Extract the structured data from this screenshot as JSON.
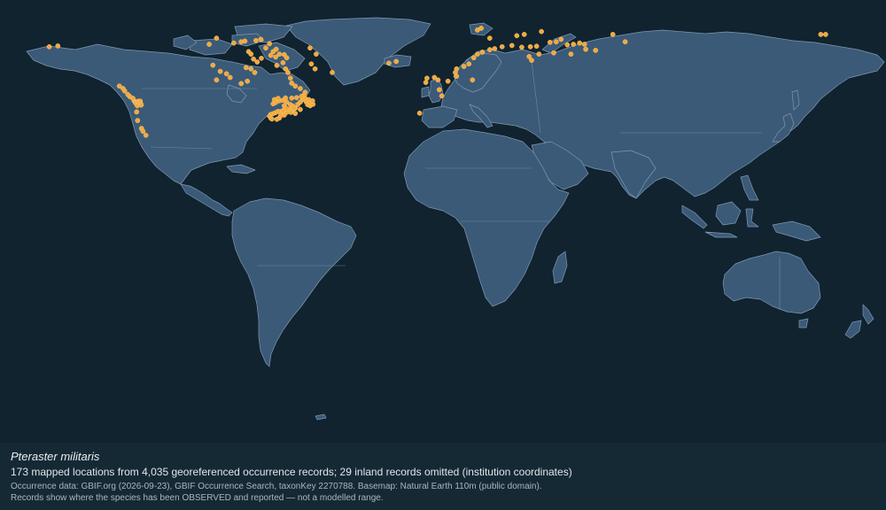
{
  "caption": {
    "species": "Pteraster militaris",
    "summary": "173 mapped locations from 4,035 georeferenced occurrence records; 29 inland records omitted (institution coordinates)",
    "source": "Occurrence data: GBIF.org (2026-09-23), GBIF Occurrence Search, taxonKey 2270788. Basemap: Natural Earth 110m (public domain).",
    "note": "Records show where the species has been OBSERVED and reported — not a modelled range."
  },
  "colors": {
    "ocean": "#10232f",
    "land": "#3b5a78",
    "border": "#7f98b2",
    "occurrence_point": "#f2a93b",
    "caption_bg": "#152935"
  },
  "map": {
    "projection": "equirectangular",
    "basemap": "Natural Earth 110m",
    "occurrences": [
      [
        -125.5,
        49.0
      ],
      [
        -125.0,
        48.4
      ],
      [
        -124.8,
        48.1
      ],
      [
        -124.5,
        47.6
      ],
      [
        -124.2,
        47.0
      ],
      [
        -123.9,
        48.8
      ],
      [
        -123.4,
        48.4
      ],
      [
        -123.0,
        48.9
      ],
      [
        -122.8,
        47.8
      ],
      [
        -122.6,
        47.3
      ],
      [
        -126.0,
        50.0
      ],
      [
        -127.2,
        50.7
      ],
      [
        -128.0,
        51.5
      ],
      [
        -129.3,
        53.0
      ],
      [
        -130.0,
        54.0
      ],
      [
        -131.5,
        55.0
      ],
      [
        -124.5,
        44.5
      ],
      [
        -124.1,
        41.0
      ],
      [
        -122.5,
        37.8
      ],
      [
        -121.9,
        36.6
      ],
      [
        -120.7,
        35.0
      ],
      [
        -160.0,
        71.0
      ],
      [
        -156.5,
        71.3
      ],
      [
        -95.0,
        72.0
      ],
      [
        -92.0,
        74.5
      ],
      [
        -85.0,
        72.5
      ],
      [
        -82.0,
        73.0
      ],
      [
        -80.5,
        73.3
      ],
      [
        -79.0,
        69.0
      ],
      [
        -78.0,
        68.0
      ],
      [
        -77.0,
        66.0
      ],
      [
        -75.5,
        64.8
      ],
      [
        -73.8,
        66.3
      ],
      [
        -70.0,
        67.5
      ],
      [
        -68.0,
        66.8
      ],
      [
        -65.0,
        64.5
      ],
      [
        -64.0,
        62.0
      ],
      [
        -63.0,
        60.5
      ],
      [
        -62.0,
        58.3
      ],
      [
        -61.5,
        56.2
      ],
      [
        -60.0,
        55.0
      ],
      [
        -58.0,
        54.0
      ],
      [
        -56.0,
        52.5
      ],
      [
        -67.5,
        63.4
      ],
      [
        -66.5,
        68.0
      ],
      [
        -64.5,
        67.8
      ],
      [
        -63.5,
        66.5
      ],
      [
        -72.0,
        70.5
      ],
      [
        -70.5,
        72.2
      ],
      [
        -74.0,
        74.0
      ],
      [
        -76.0,
        73.5
      ],
      [
        -69.0,
        69.0
      ],
      [
        -67.8,
        70.0
      ],
      [
        -88.0,
        60.0
      ],
      [
        -86.5,
        58.5
      ],
      [
        -92.0,
        57.5
      ],
      [
        -80.0,
        62.5
      ],
      [
        -78.0,
        62.0
      ],
      [
        -76.5,
        60.5
      ],
      [
        -79.5,
        57.0
      ],
      [
        -82.0,
        56.0
      ],
      [
        -93.5,
        63.5
      ],
      [
        -90.5,
        61.0
      ],
      [
        -52.0,
        62.0
      ],
      [
        -53.5,
        64.0
      ],
      [
        -51.5,
        68.0
      ],
      [
        -54.0,
        70.5
      ],
      [
        -45.0,
        60.5
      ],
      [
        -69.0,
        47.8
      ],
      [
        -68.0,
        48.3
      ],
      [
        -66.5,
        49.0
      ],
      [
        -65.0,
        49.2
      ],
      [
        -63.5,
        48.5
      ],
      [
        -62.0,
        47.5
      ],
      [
        -61.0,
        46.8
      ],
      [
        -60.0,
        46.0
      ],
      [
        -59.0,
        47.5
      ],
      [
        -58.0,
        48.5
      ],
      [
        -57.0,
        49.5
      ],
      [
        -56.0,
        50.0
      ],
      [
        -55.5,
        48.5
      ],
      [
        -55.0,
        47.5
      ],
      [
        -54.0,
        47.0
      ],
      [
        -53.5,
        48.0
      ],
      [
        -52.8,
        47.6
      ],
      [
        -53.0,
        49.0
      ],
      [
        -54.5,
        49.5
      ],
      [
        -56.5,
        51.3
      ],
      [
        -64.5,
        47.0
      ],
      [
        -64.0,
        46.0
      ],
      [
        -63.0,
        45.0
      ],
      [
        -62.0,
        44.8
      ],
      [
        -61.0,
        45.3
      ],
      [
        -60.5,
        46.2
      ],
      [
        -66.0,
        44.5
      ],
      [
        -65.5,
        43.8
      ],
      [
        -64.5,
        43.2
      ],
      [
        -63.5,
        44.3
      ],
      [
        -67.0,
        44.7
      ],
      [
        -68.0,
        44.2
      ],
      [
        -69.0,
        43.8
      ],
      [
        -70.0,
        43.5
      ],
      [
        -70.5,
        42.8
      ],
      [
        -70.0,
        42.0
      ],
      [
        -69.5,
        41.6
      ],
      [
        -66.5,
        42.0
      ],
      [
        -67.5,
        41.5
      ],
      [
        -66.0,
        43.0
      ],
      [
        -62.5,
        45.6
      ],
      [
        -63.5,
        45.6
      ],
      [
        -65.0,
        45.0
      ],
      [
        -68.5,
        49.5
      ],
      [
        -67.0,
        50.0
      ],
      [
        -64.0,
        50.2
      ],
      [
        -61.5,
        50.1
      ],
      [
        -59.5,
        50.3
      ],
      [
        -57.5,
        50.8
      ],
      [
        -60.0,
        43.9
      ],
      [
        -58.0,
        45.5
      ],
      [
        -61.8,
        44.3
      ],
      [
        15.5,
        78.5
      ],
      [
        14.0,
        77.8
      ],
      [
        19.0,
        74.5
      ],
      [
        30.0,
        75.5
      ],
      [
        33.0,
        76.0
      ],
      [
        40.0,
        77.2
      ],
      [
        43.5,
        72.8
      ],
      [
        46.0,
        73.0
      ],
      [
        48.0,
        74.0
      ],
      [
        50.5,
        71.8
      ],
      [
        53.0,
        72.0
      ],
      [
        55.5,
        72.5
      ],
      [
        57.5,
        72.0
      ],
      [
        38.0,
        71.2
      ],
      [
        35.5,
        71.0
      ],
      [
        32.0,
        70.8
      ],
      [
        28.0,
        71.5
      ],
      [
        24.0,
        71.0
      ],
      [
        21.0,
        70.2
      ],
      [
        19.0,
        69.8
      ],
      [
        16.0,
        68.8
      ],
      [
        14.0,
        68.0
      ],
      [
        12.5,
        66.5
      ],
      [
        10.5,
        64.0
      ],
      [
        8.5,
        63.0
      ],
      [
        5.5,
        62.0
      ],
      [
        5.0,
        60.5
      ],
      [
        5.5,
        59.0
      ],
      [
        2.0,
        57.0
      ],
      [
        -2.0,
        57.5
      ],
      [
        -3.5,
        58.5
      ],
      [
        -6.5,
        58.2
      ],
      [
        -7.0,
        56.5
      ],
      [
        -0.5,
        51.0
      ],
      [
        -9.5,
        44.0
      ],
      [
        -1.5,
        53.5
      ],
      [
        -19.0,
        65.0
      ],
      [
        -22.0,
        64.3
      ],
      [
        36.0,
        65.5
      ],
      [
        39.0,
        68.0
      ],
      [
        35.0,
        67.0
      ],
      [
        45.0,
        68.5
      ],
      [
        52.0,
        68.0
      ],
      [
        58.0,
        70.0
      ],
      [
        62.0,
        69.5
      ],
      [
        74.0,
        73.0
      ],
      [
        69.0,
        76.0
      ],
      [
        155.5,
        76.0
      ],
      [
        153.5,
        76.0
      ],
      [
        12.0,
        57.5
      ]
    ]
  }
}
